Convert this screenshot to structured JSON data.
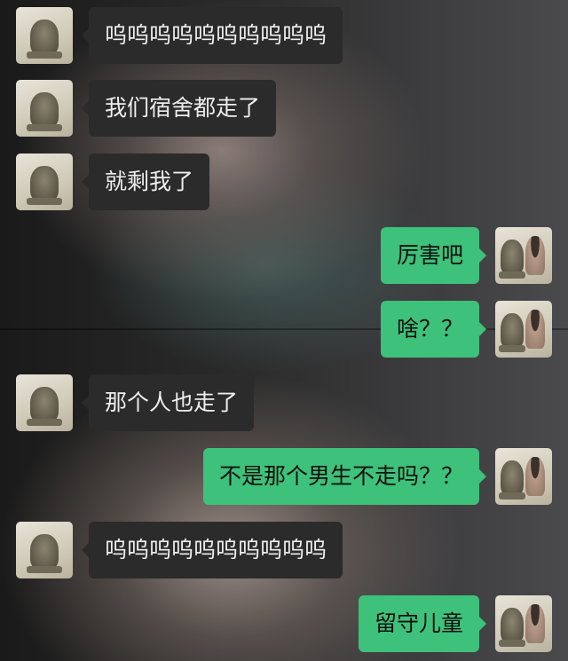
{
  "chat": {
    "messages": [
      {
        "side": "left",
        "text": "呜呜呜呜呜呜呜呜呜呜"
      },
      {
        "side": "left",
        "text": "我们宿舍都走了"
      },
      {
        "side": "left",
        "text": "就剩我了"
      },
      {
        "side": "right",
        "text": "厉害吧"
      },
      {
        "side": "right",
        "text": "啥？？"
      },
      {
        "side": "left",
        "text": "那个人也走了"
      },
      {
        "side": "right",
        "text": "不是那个男生不走吗？？"
      },
      {
        "side": "left",
        "text": "呜呜呜呜呜呜呜呜呜呜"
      },
      {
        "side": "right",
        "text": "留守儿童"
      }
    ]
  },
  "colors": {
    "sent_bubble": "#3ec17a",
    "received_bubble": "#2b2b2b"
  },
  "icons": {
    "received_avatar": "stone-lion-avatar",
    "sent_avatar": "lion-and-girl-avatar"
  }
}
